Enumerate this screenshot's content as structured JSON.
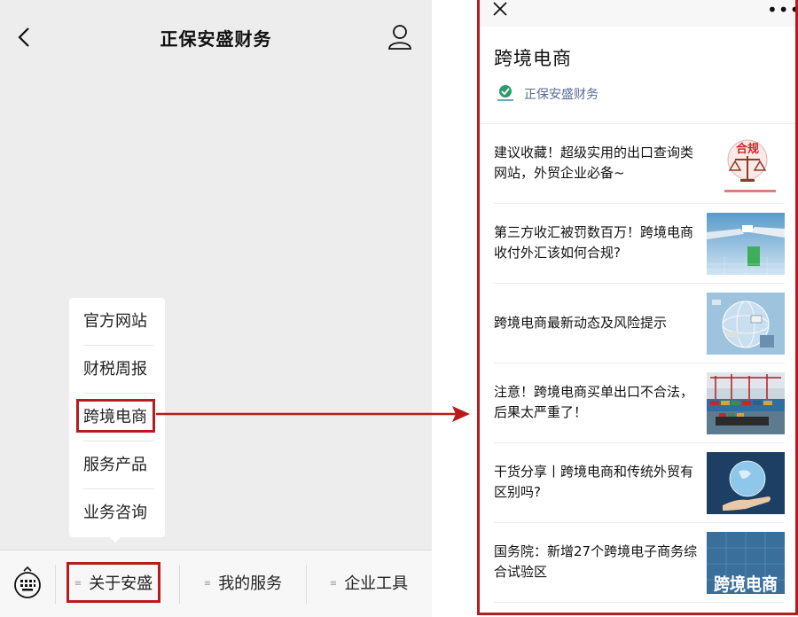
{
  "left_screen": {
    "title": "正保安盛财务",
    "popup_menu": {
      "items": [
        "官方网站",
        "财税周报",
        "跨境电商",
        "服务产品",
        "业务咨询"
      ],
      "highlighted_index": 2
    },
    "bottom_menu": {
      "tabs": [
        {
          "label": "关于安盛",
          "highlighted": true
        },
        {
          "label": "我的服务"
        },
        {
          "label": "企业工具"
        }
      ],
      "keyboard_icon": "keyboard-icon"
    },
    "icons": {
      "back": "back-icon",
      "profile": "profile-icon"
    }
  },
  "right_screen": {
    "album_title": "跨境电商",
    "account_name": "正保安盛财务",
    "articles": [
      {
        "title": "建议收藏！超级实用的出口查询类网站，外贸企业必备~",
        "thumb_text": "合规"
      },
      {
        "title": "第三方收汇被罚数百万！跨境电商收付外汇该如何合规?",
        "thumb_text": ""
      },
      {
        "title": "跨境电商最新动态及风险提示",
        "thumb_text": ""
      },
      {
        "title": "注意！跨境电商买单出口不合法，后果太严重了！",
        "thumb_text": ""
      },
      {
        "title": "干货分享丨跨境电商和传统外贸有区别吗?",
        "thumb_text": ""
      },
      {
        "title": "国务院：新增27个跨境电子商务综合试验区",
        "thumb_text": "跨境电商"
      }
    ],
    "icons": {
      "close": "close-icon",
      "more": "more-icon"
    }
  },
  "colors": {
    "highlight": "#b71c1c",
    "link": "#576b95",
    "left_bg": "#ededed"
  }
}
